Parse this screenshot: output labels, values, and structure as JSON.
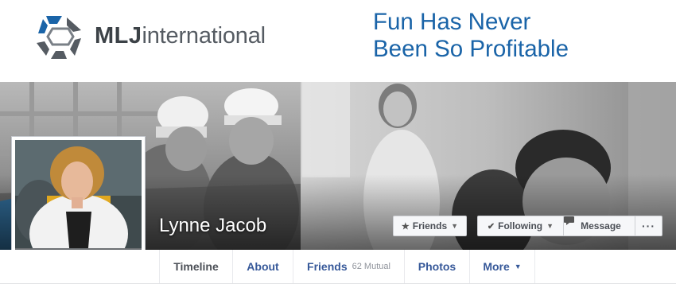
{
  "banner": {
    "logo_bold": "MLJ",
    "logo_rest": "international",
    "tagline_line1": "Fun Has Never",
    "tagline_line2": "Been So Profitable",
    "brand_blue": "#1a64a8",
    "brand_grey": "#555b62"
  },
  "cover": {
    "name": "Lynne Jacob",
    "buttons": {
      "friends": {
        "icon": "star-icon",
        "label": "Friends"
      },
      "following": {
        "icon": "check-icon",
        "label": "Following"
      },
      "message": {
        "icon": "message-icon",
        "label": "Message"
      },
      "more": {
        "label": "···"
      }
    }
  },
  "nav": {
    "tabs": [
      {
        "label": "Timeline",
        "active": true
      },
      {
        "label": "About"
      },
      {
        "label": "Friends",
        "sub": "62 Mutual"
      },
      {
        "label": "Photos"
      },
      {
        "label": "More"
      }
    ]
  }
}
